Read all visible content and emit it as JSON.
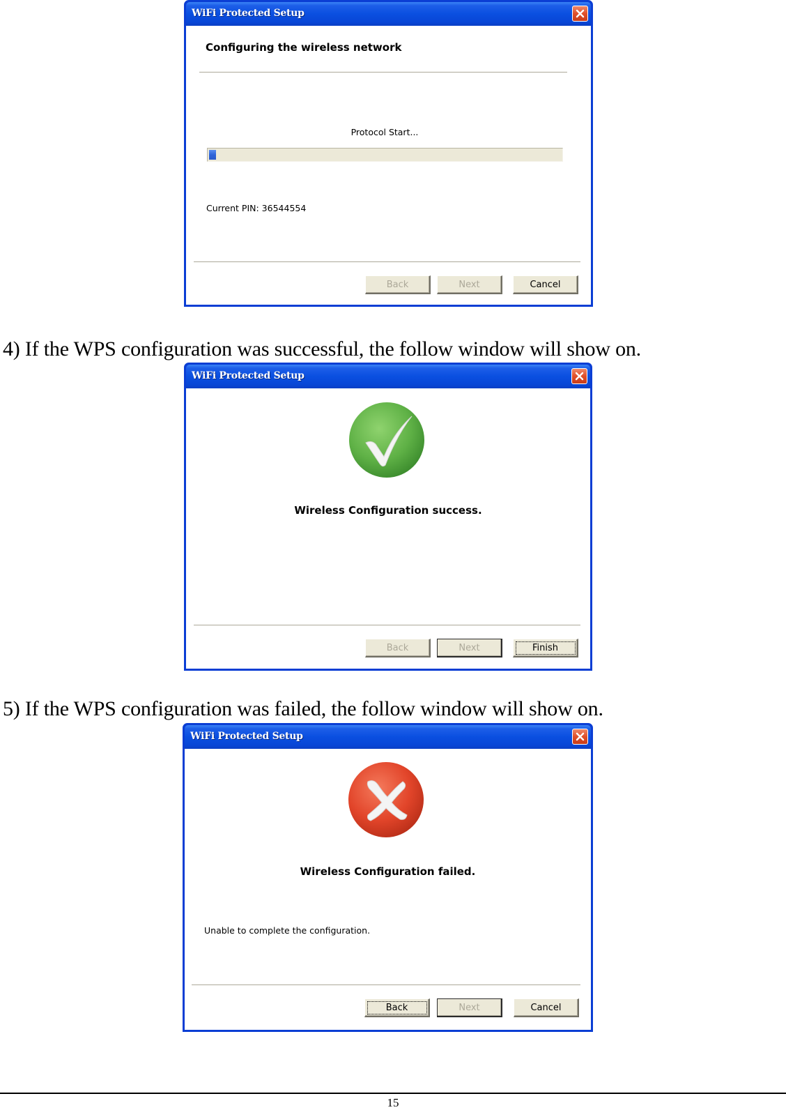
{
  "document": {
    "captions": [
      "4) If the WPS configuration was successful, the follow window will show on.",
      "5) If the WPS configuration was failed, the follow window will show on."
    ],
    "page_number": "15"
  },
  "dialogs": [
    {
      "title": "WiFi Protected Setup",
      "close_icon": "close-icon",
      "heading": "Configuring the wireless network",
      "progress_label": "Protocol Start...",
      "progress_percent": 2,
      "pin_text": "Current PIN: 36544554",
      "buttons": [
        {
          "label": "Back",
          "enabled": false
        },
        {
          "label": "Next",
          "enabled": false
        },
        {
          "label": "Cancel",
          "enabled": true
        }
      ]
    },
    {
      "title": "WiFi Protected Setup",
      "close_icon": "close-icon",
      "status_icon": "success-check-icon",
      "status_text": "Wireless Configuration success.",
      "buttons": [
        {
          "label": "Back",
          "enabled": false
        },
        {
          "label": "Next",
          "enabled": false
        },
        {
          "label": "Finish",
          "enabled": true,
          "focused": true
        }
      ]
    },
    {
      "title": "WiFi Protected Setup",
      "close_icon": "close-icon",
      "status_icon": "failure-x-icon",
      "status_text": "Wireless Configuration failed.",
      "detail_text": "Unable to complete the configuration.",
      "buttons": [
        {
          "label": "Back",
          "enabled": true,
          "focused": true
        },
        {
          "label": "Next",
          "enabled": false
        },
        {
          "label": "Cancel",
          "enabled": true
        }
      ]
    }
  ],
  "colors": {
    "titlebar_blue": "#0a4fe0",
    "progress_blue": "#2f64d8",
    "success_green": "#5fb146",
    "failure_red": "#e2452a",
    "button_face": "#ece9d8",
    "disabled_text": "#aca899"
  }
}
